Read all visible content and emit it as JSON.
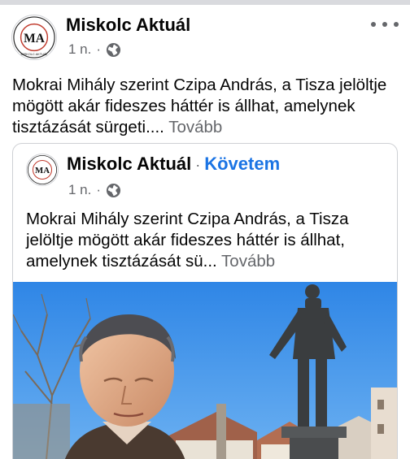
{
  "post": {
    "page_name": "Miskolc Aktuál",
    "time": "1 n.",
    "meta_separator": "·",
    "privacy_icon": "globe-icon",
    "text": "Mokrai Mihály szerint Czipa András, a Tisza jelöltje mögött akár fideszes háttér is állhat, amelynek tisztázását sürgeti....",
    "see_more": "Tovább",
    "more_icon": "more-options-icon"
  },
  "logo": {
    "monogram": "MA",
    "ring_text": "MISKOLC AKTUÁL"
  },
  "shared": {
    "page_name": "Miskolc Aktuál",
    "separator": "·",
    "follow_label": "Követem",
    "time": "1 n.",
    "meta_separator": "·",
    "text": "Mokrai Mihály szerint Czipa András, a Tisza jelöltje mögött akár fideszes háttér is állhat, amelynek tisztázását sü...",
    "see_more": "Tovább"
  },
  "colors": {
    "link_blue": "#1b74e4",
    "secondary_text": "#65676b",
    "sky": "#3b8fe8"
  }
}
